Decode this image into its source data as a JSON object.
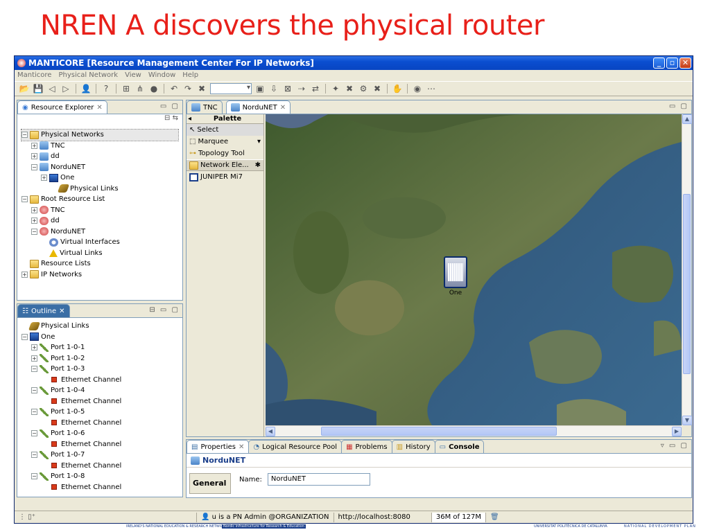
{
  "slide": {
    "title": "NREN A discovers the physical router"
  },
  "window": {
    "title": "MANTICORE [Resource Management Center For IP Networks]",
    "controls": [
      "_",
      "▫",
      "✕"
    ]
  },
  "menu": [
    "Manticore",
    "Physical Network",
    "View",
    "Window",
    "Help"
  ],
  "resource_explorer": {
    "tab_label": "Resource Explorer",
    "tree": [
      {
        "label": "Physical Networks",
        "icon": "folder-icon",
        "depth": 0,
        "twisty": "−",
        "selected": true
      },
      {
        "label": "TNC",
        "icon": "network-icon",
        "depth": 1,
        "twisty": "+"
      },
      {
        "label": "dd",
        "icon": "network-icon",
        "depth": 1,
        "twisty": "+"
      },
      {
        "label": "NorduNET",
        "icon": "network-icon",
        "depth": 1,
        "twisty": "−"
      },
      {
        "label": "One",
        "icon": "router-icon",
        "depth": 2,
        "twisty": "+"
      },
      {
        "label": "Physical Links",
        "icon": "links-icon",
        "depth": 3,
        "twisty": ""
      },
      {
        "label": "Root Resource List",
        "icon": "folder-icon",
        "depth": 0,
        "twisty": "−"
      },
      {
        "label": "TNC",
        "icon": "resource-icon",
        "depth": 1,
        "twisty": "+"
      },
      {
        "label": "dd",
        "icon": "resource-icon",
        "depth": 1,
        "twisty": "+"
      },
      {
        "label": "NorduNET",
        "icon": "resource-icon",
        "depth": 1,
        "twisty": "−"
      },
      {
        "label": "Virtual Interfaces",
        "icon": "gear-icon",
        "depth": 2,
        "twisty": ""
      },
      {
        "label": "Virtual Links",
        "icon": "warning-icon",
        "depth": 2,
        "twisty": ""
      },
      {
        "label": "Resource Lists",
        "icon": "folder-icon",
        "depth": 0,
        "twisty": ""
      },
      {
        "label": "IP Networks",
        "icon": "folder-icon",
        "depth": 0,
        "twisty": "+"
      }
    ]
  },
  "outline": {
    "tab_label": "Outline",
    "tree": [
      {
        "label": "Physical Links",
        "icon": "links-icon",
        "depth": 0,
        "twisty": ""
      },
      {
        "label": "One",
        "icon": "router-icon",
        "depth": 0,
        "twisty": "−"
      },
      {
        "label": "Port 1-0-1",
        "icon": "port-icon",
        "depth": 1,
        "twisty": "+"
      },
      {
        "label": "Port 1-0-2",
        "icon": "port-icon",
        "depth": 1,
        "twisty": "+"
      },
      {
        "label": "Port 1-0-3",
        "icon": "port-icon",
        "depth": 1,
        "twisty": "−"
      },
      {
        "label": "Ethernet Channel",
        "icon": "ethernet-icon",
        "depth": 2,
        "twisty": ""
      },
      {
        "label": "Port 1-0-4",
        "icon": "port-icon",
        "depth": 1,
        "twisty": "−"
      },
      {
        "label": "Ethernet Channel",
        "icon": "ethernet-icon",
        "depth": 2,
        "twisty": ""
      },
      {
        "label": "Port 1-0-5",
        "icon": "port-icon",
        "depth": 1,
        "twisty": "−"
      },
      {
        "label": "Ethernet Channel",
        "icon": "ethernet-icon",
        "depth": 2,
        "twisty": ""
      },
      {
        "label": "Port 1-0-6",
        "icon": "port-icon",
        "depth": 1,
        "twisty": "−"
      },
      {
        "label": "Ethernet Channel",
        "icon": "ethernet-icon",
        "depth": 2,
        "twisty": ""
      },
      {
        "label": "Port 1-0-7",
        "icon": "port-icon",
        "depth": 1,
        "twisty": "−"
      },
      {
        "label": "Ethernet Channel",
        "icon": "ethernet-icon",
        "depth": 2,
        "twisty": ""
      },
      {
        "label": "Port 1-0-8",
        "icon": "port-icon",
        "depth": 1,
        "twisty": "−"
      },
      {
        "label": "Ethernet Channel",
        "icon": "ethernet-icon",
        "depth": 2,
        "twisty": ""
      }
    ]
  },
  "editor": {
    "tabs": [
      {
        "label": "TNC",
        "active": false
      },
      {
        "label": "NorduNET",
        "active": true
      }
    ],
    "palette": {
      "header": "Palette",
      "items": [
        "Select",
        "Marquee",
        "Topology Tool"
      ],
      "drawer": "Network Ele...",
      "drawer_items": [
        "JUNIPER Mi7"
      ]
    },
    "map_node_label": "One"
  },
  "properties": {
    "tabs": [
      "Properties",
      "Logical Resource Pool",
      "Problems",
      "History",
      "Console"
    ],
    "title": "NorduNET",
    "section_tab": "General",
    "name_label": "Name:",
    "name_value": "NorduNET"
  },
  "status": {
    "user": "u is a PN Admin @ORGANIZATION",
    "url": "http://localhost:8080",
    "memory": "36M of 127M"
  },
  "footer": {
    "left": "IRELAND'S NATIONAL EDUCATION & RESEARCH NETWORK",
    "middle": "Nordic infrastructure for Research & Education",
    "right1": "UNIVERSITAT POLITÈCNICA DE CATALUNYA",
    "right2": "NATIONAL DEVELOPMENT PLAN"
  },
  "colors": {
    "title": "#e8201a",
    "titlebar": "#0a4ed0"
  }
}
